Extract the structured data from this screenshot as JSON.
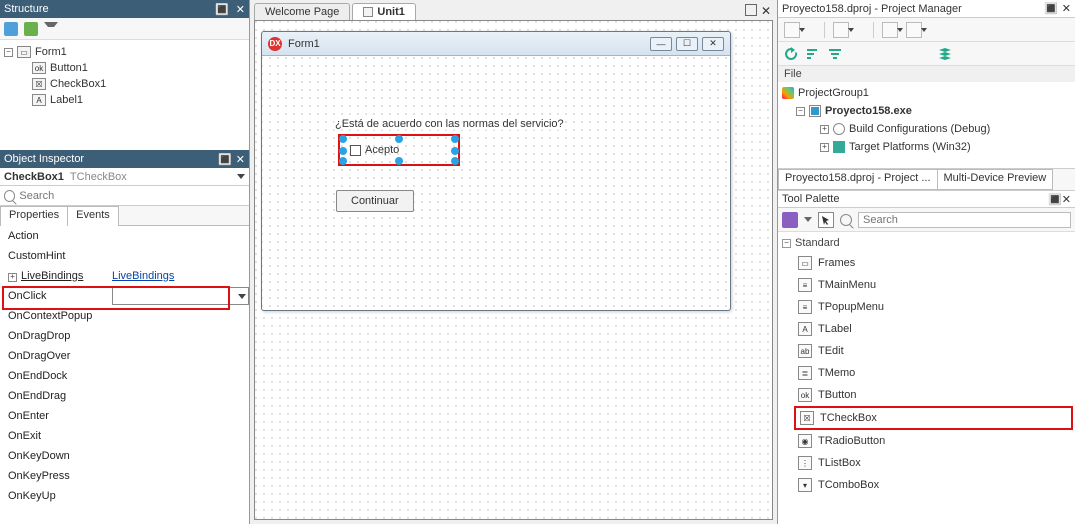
{
  "structure": {
    "title": "Structure",
    "tree": {
      "root": "Form1",
      "items": [
        "Button1",
        "CheckBox1",
        "Label1"
      ]
    }
  },
  "inspector": {
    "title": "Object Inspector",
    "component": "CheckBox1",
    "type": "TCheckBox",
    "search_placeholder": "Search",
    "tabs": [
      "Properties",
      "Events"
    ],
    "events": [
      {
        "name": "Action",
        "value": "",
        "style": "red"
      },
      {
        "name": "CustomHint",
        "value": "",
        "style": "red"
      },
      {
        "name": "LiveBindings",
        "value": "LiveBindings",
        "style": "link",
        "exp": true
      },
      {
        "name": "OnClick",
        "value": "",
        "style": "sel"
      },
      {
        "name": "OnContextPopup",
        "value": ""
      },
      {
        "name": "OnDragDrop",
        "value": ""
      },
      {
        "name": "OnDragOver",
        "value": ""
      },
      {
        "name": "OnEndDock",
        "value": ""
      },
      {
        "name": "OnEndDrag",
        "value": ""
      },
      {
        "name": "OnEnter",
        "value": ""
      },
      {
        "name": "OnExit",
        "value": ""
      },
      {
        "name": "OnKeyDown",
        "value": ""
      },
      {
        "name": "OnKeyPress",
        "value": ""
      },
      {
        "name": "OnKeyUp",
        "value": ""
      }
    ]
  },
  "editor": {
    "tabs": [
      "Welcome Page",
      "Unit1"
    ],
    "form_title": "Form1",
    "label_text": "¿Está de acuerdo con las normas del servicio?",
    "checkbox_label": "Acepto",
    "button_label": "Continuar"
  },
  "project_manager": {
    "title": "Proyecto158.dproj - Project Manager",
    "file_label": "File",
    "tree": {
      "group": "ProjectGroup1",
      "project": "Proyecto158.exe",
      "build": "Build Configurations (Debug)",
      "target": "Target Platforms (Win32)"
    },
    "bottom_tabs": [
      "Proyecto158.dproj - Project ...",
      "Multi-Device Preview"
    ]
  },
  "palette": {
    "title": "Tool Palette",
    "search_placeholder": "Search",
    "category": "Standard",
    "items": [
      "Frames",
      "TMainMenu",
      "TPopupMenu",
      "TLabel",
      "TEdit",
      "TMemo",
      "TButton",
      "TCheckBox",
      "TRadioButton",
      "TListBox",
      "TComboBox"
    ]
  }
}
